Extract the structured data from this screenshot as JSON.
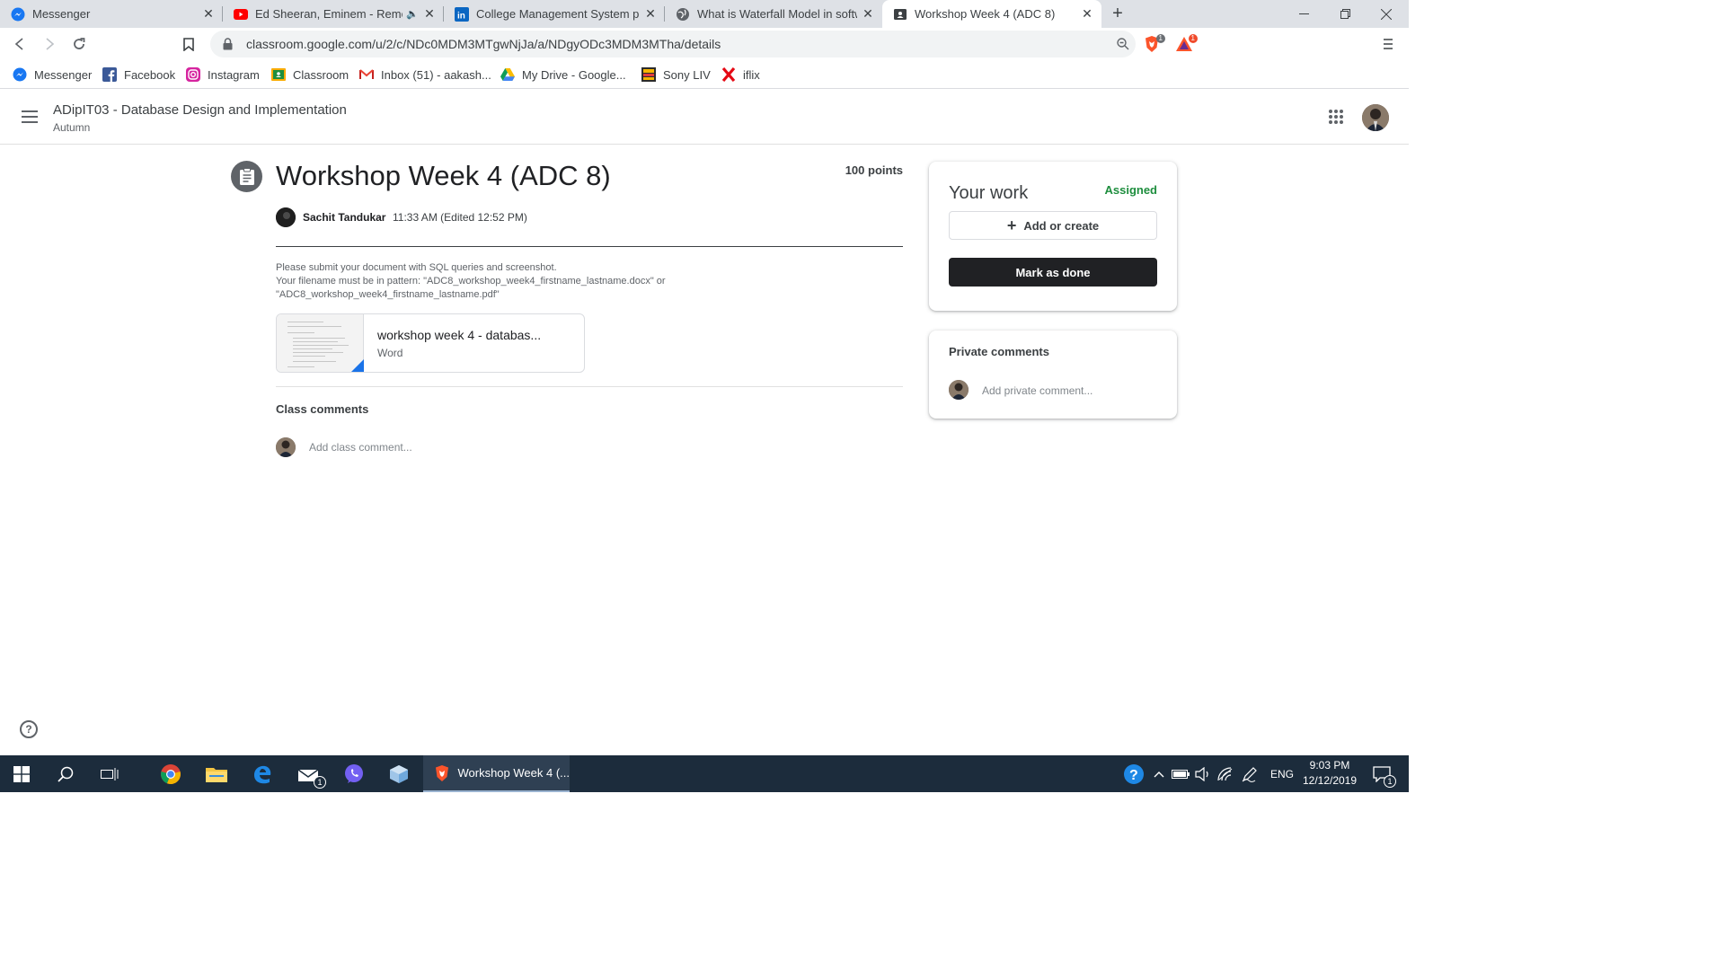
{
  "browser": {
    "tabs": [
      {
        "title": "Messenger",
        "icon": "messenger-icon"
      },
      {
        "title": "Ed Sheeran, Eminem - Remem",
        "icon": "youtube-icon",
        "audio": "🔈"
      },
      {
        "title": "College Management System proj",
        "icon": "linkedin-icon"
      },
      {
        "title": "What is Waterfall Model in softwar",
        "icon": "globe-icon"
      },
      {
        "title": "Workshop Week 4 (ADC 8)",
        "icon": "classroom-icon",
        "active": true
      }
    ],
    "url": "classroom.google.com/u/2/c/NDc0MDM3MTgwNjJa/a/NDgyODc3MDM3MTha/details",
    "extension_badges": {
      "brave": "1",
      "rewards": "1"
    },
    "bookmarks": [
      {
        "label": "Messenger",
        "icon": "messenger-icon"
      },
      {
        "label": "Facebook",
        "icon": "facebook-icon"
      },
      {
        "label": "Instagram",
        "icon": "instagram-icon"
      },
      {
        "label": "Classroom",
        "icon": "classroom-icon"
      },
      {
        "label": "Inbox (51) - aakash...",
        "icon": "gmail-icon"
      },
      {
        "label": "My Drive - Google...",
        "icon": "drive-icon"
      },
      {
        "label": "Sony LIV",
        "icon": "sonyliv-icon"
      },
      {
        "label": "iflix",
        "icon": "iflix-icon"
      }
    ]
  },
  "header": {
    "course_title": "ADipIT03 - Database Design and Implementation",
    "course_subtitle": "Autumn"
  },
  "assignment": {
    "title": "Workshop Week 4 (ADC 8)",
    "points": "100 points",
    "author": "Sachit Tandukar",
    "posted": "11:33 AM (Edited 12:52 PM)",
    "description_lines": [
      "Please submit your document with SQL queries and screenshot.",
      "Your filename must be in pattern: \"ADC8_workshop_week4_firstname_lastname.docx\" or",
      "\"ADC8_workshop_week4_firstname_lastname.pdf\""
    ],
    "attachment": {
      "name": "workshop week 4 - databas...",
      "type": "Word"
    },
    "class_comments_label": "Class comments",
    "class_comment_placeholder": "Add class comment..."
  },
  "your_work": {
    "title": "Your work",
    "status": "Assigned",
    "add_label": "Add or create",
    "done_label": "Mark as done"
  },
  "private_comments": {
    "title": "Private comments",
    "placeholder": "Add private comment..."
  },
  "taskbar": {
    "active_app": "Workshop Week 4 (...",
    "mail_badge": "1",
    "language": "ENG",
    "time": "9:03 PM",
    "date": "12/12/2019",
    "notification_badge": "1"
  },
  "colors": {
    "status_assigned": "#1e8e3e",
    "primary_button": "#202124",
    "taskbar": "#1c2c3c"
  }
}
